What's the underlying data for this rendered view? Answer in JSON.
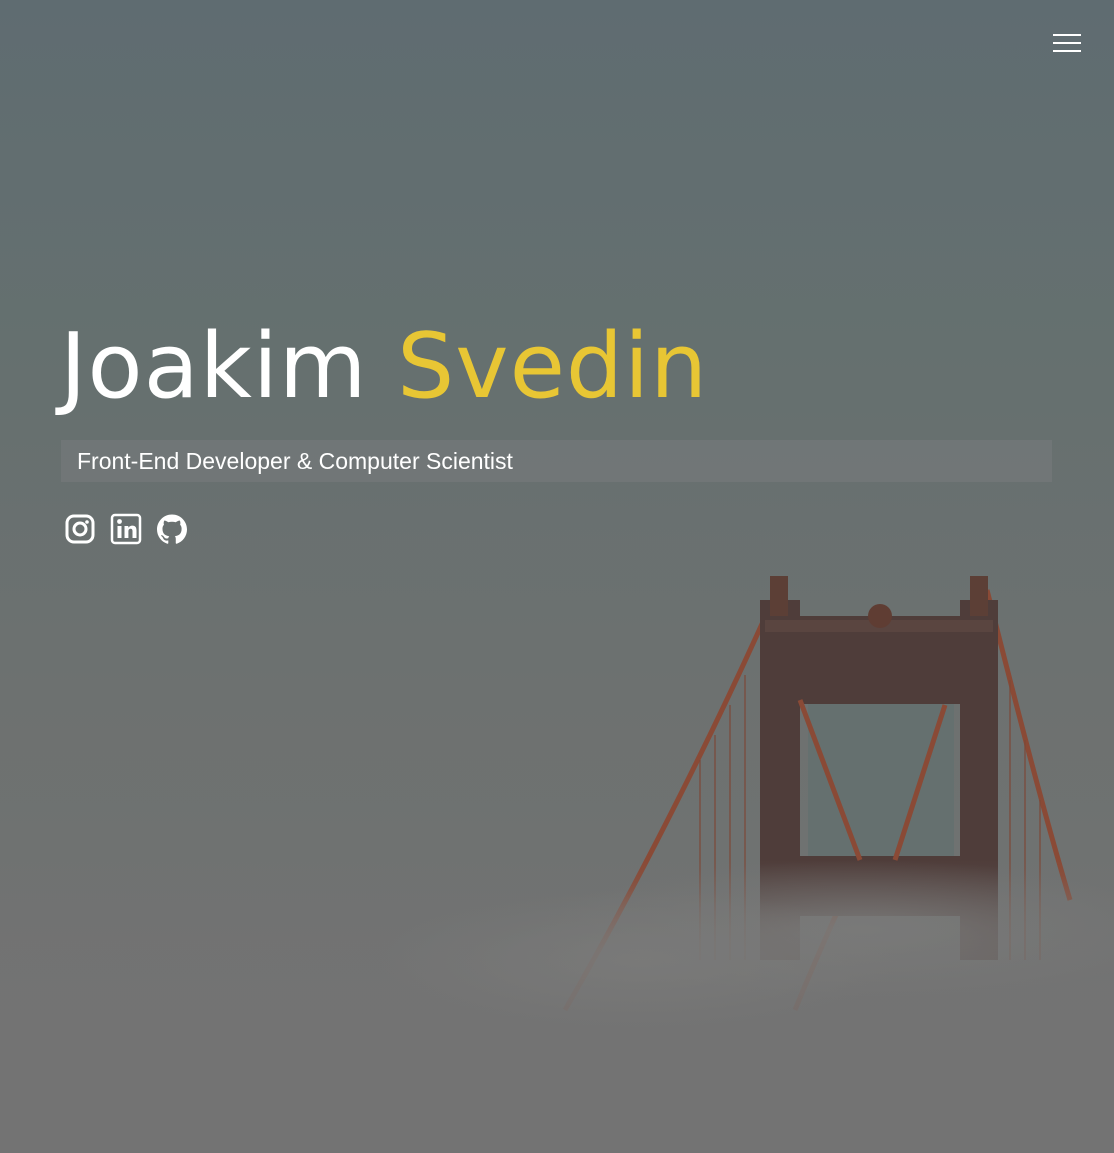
{
  "header": {
    "menu_icon": "hamburger-menu-icon"
  },
  "hero": {
    "first_name": "Joakim",
    "last_name": "Svedin",
    "tagline": "Front-End Developer & Computer Scientist",
    "background_image": "golden-gate-bridge-in-fog",
    "colors": {
      "accent": "#e8c634",
      "text": "#ffffff",
      "overlay": "#6b7272"
    }
  },
  "social": [
    {
      "icon": "instagram-icon"
    },
    {
      "icon": "linkedin-icon"
    },
    {
      "icon": "github-icon"
    }
  ]
}
